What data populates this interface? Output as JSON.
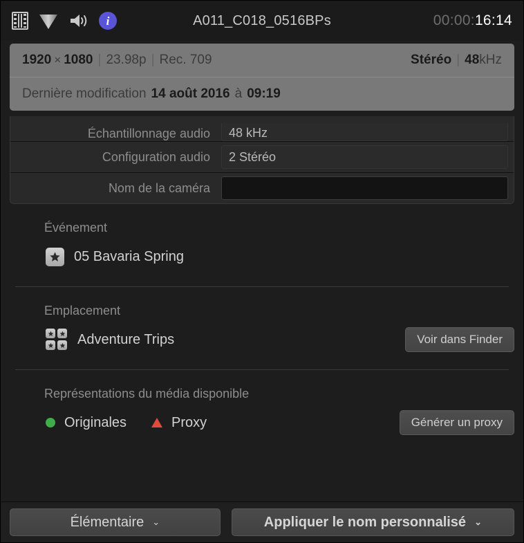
{
  "header": {
    "icons": [
      {
        "name": "film-strip-icon",
        "label": "film-strip"
      },
      {
        "name": "video-scope-icon",
        "label": "triangle"
      },
      {
        "name": "audio-speaker-icon",
        "label": "speaker"
      },
      {
        "name": "info-icon",
        "label": "i"
      }
    ],
    "info_glyph": "i",
    "title": "A011_C018_0516BPs",
    "timecode_dim": "00:00:",
    "timecode_bright": "16:14",
    "accent_color": "#5a54d6"
  },
  "summary": {
    "width": "1920",
    "times": "×",
    "height": "1080",
    "sep1": "|",
    "framerate": "23.98p",
    "sep2": "|",
    "colorspace": "Rec. 709",
    "audio_channels": "Stéréo",
    "sep3": "|",
    "audio_rate_num": "48",
    "audio_rate_unit": "kHz",
    "modified_label": "Dernière modification",
    "modified_date": "14 août 2016",
    "modified_at": "à",
    "modified_time": "09:19"
  },
  "table": {
    "rows": [
      {
        "label": "Échantillonnage audio",
        "value": "48 kHz",
        "empty": false
      },
      {
        "label": "Configuration audio",
        "value": "2 Stéréo",
        "empty": false
      },
      {
        "label": "Nom de la caméra",
        "value": "",
        "empty": true
      }
    ]
  },
  "event_section": {
    "title": "Événement",
    "icon": "event-star-icon",
    "name": "05 Bavaria Spring"
  },
  "location_section": {
    "title": "Emplacement",
    "icon": "library-grid-icon",
    "name": "Adventure Trips",
    "button": "Voir dans Finder"
  },
  "media_section": {
    "title": "Représentations du média disponible",
    "items": [
      {
        "label": "Originales",
        "marker": "green-circle-icon",
        "color": "#3fae49"
      },
      {
        "label": "Proxy",
        "marker": "red-triangle-icon",
        "color": "#e04a3f"
      }
    ],
    "button": "Générer un proxy"
  },
  "bottom_bar": {
    "view_menu": "Élémentaire",
    "view_menu_chevron": "⌄",
    "apply_menu": "Appliquer le nom personnalisé",
    "apply_menu_chevron": "⌄"
  }
}
